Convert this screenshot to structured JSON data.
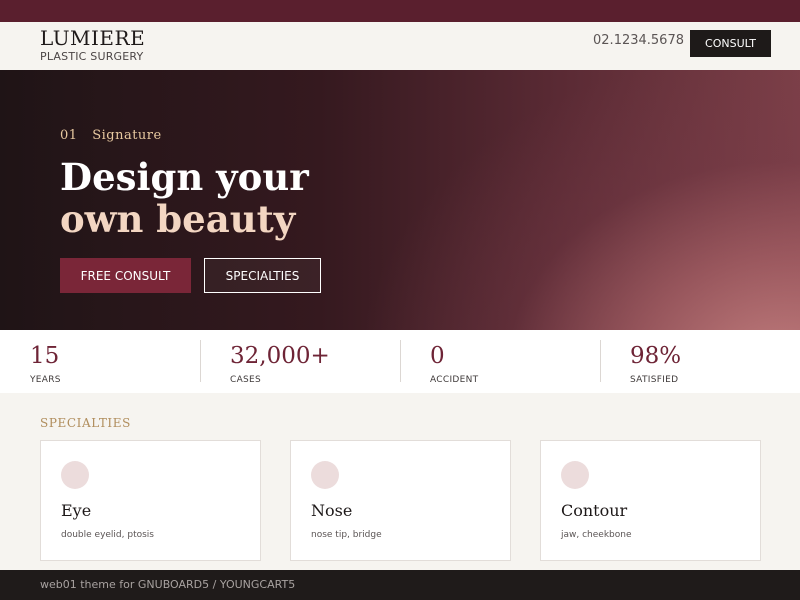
{
  "header": {
    "brand": "LUMIERE",
    "brand_sub": "PLASTIC SURGERY",
    "phone": "02.1234.5678",
    "consult_label": "CONSULT"
  },
  "hero": {
    "eyebrow_num": "01",
    "eyebrow_text": "Signature",
    "title_line1": "Design your",
    "title_line2": "own beauty",
    "primary_button": "FREE CONSULT",
    "secondary_button": "SPECIALTIES"
  },
  "stats": [
    {
      "value": "15",
      "label": "YEARS"
    },
    {
      "value": "32,000+",
      "label": "CASES"
    },
    {
      "value": "0",
      "label": "ACCIDENT"
    },
    {
      "value": "98%",
      "label": "SATISFIED"
    }
  ],
  "specialties": {
    "title": "SPECIALTIES",
    "cards": [
      {
        "title": "Eye",
        "desc": "double eyelid, ptosis"
      },
      {
        "title": "Nose",
        "desc": "nose tip, bridge"
      },
      {
        "title": "Contour",
        "desc": "jaw, cheekbone"
      }
    ]
  },
  "footer": {
    "text": "web01 theme for GNUBOARD5 / YOUNGCART5"
  },
  "colors": {
    "accent": "#7a2638",
    "topbar": "#5a1f2e",
    "gold": "#b08d5c",
    "dark": "#1e1a19"
  }
}
